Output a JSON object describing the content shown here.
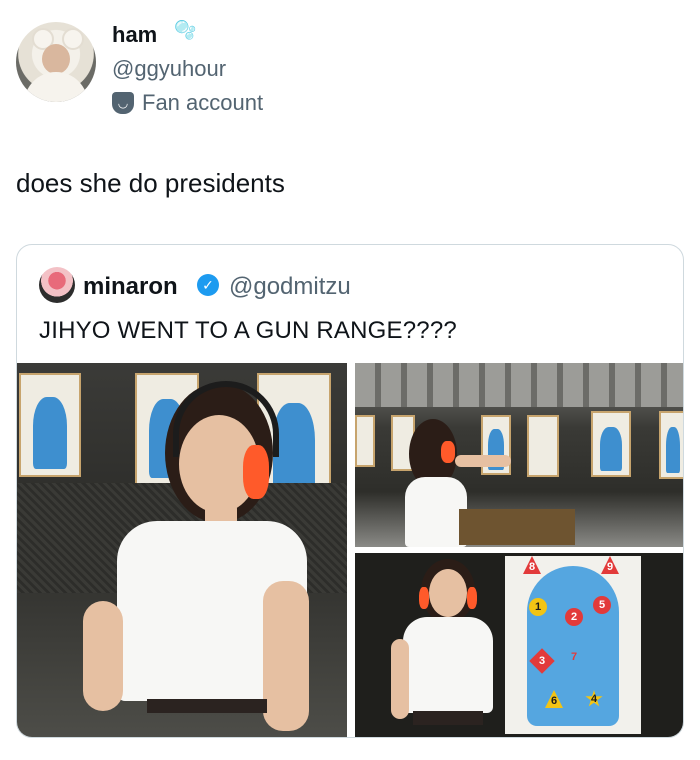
{
  "tweet": {
    "author": {
      "name": "ham",
      "name_emoji": "🫧",
      "handle": "@ggyuhour",
      "label": "Fan account"
    },
    "text": "does she do presidents"
  },
  "quoted_tweet": {
    "author": {
      "name": "minaron",
      "handle": "@godmitzu",
      "verified": true
    },
    "text": "JIHYO WENT TO A GUN RANGE????",
    "photos": [
      {
        "name": "selfie-at-range"
      },
      {
        "name": "shooting-at-range"
      },
      {
        "name": "posing-with-target"
      }
    ]
  },
  "target_markers": [
    "8",
    "9",
    "1",
    "2",
    "5",
    "3",
    "7",
    "6",
    "4"
  ],
  "colors": {
    "text": "#0f1419",
    "secondary": "#536471",
    "border": "#cfd9de",
    "verified": "#1d9bf0"
  }
}
